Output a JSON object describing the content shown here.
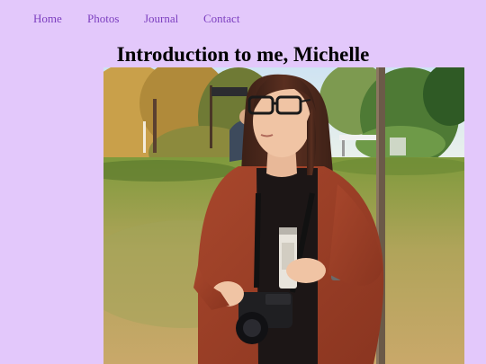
{
  "nav": {
    "items": [
      {
        "label": "Home"
      },
      {
        "label": "Photos"
      },
      {
        "label": "Journal"
      },
      {
        "label": "Contact"
      }
    ]
  },
  "page": {
    "title": "Introduction to me, Michelle"
  },
  "colors": {
    "background": "#e3c8fb",
    "link": "#7c3fbf",
    "title": "#000000"
  }
}
